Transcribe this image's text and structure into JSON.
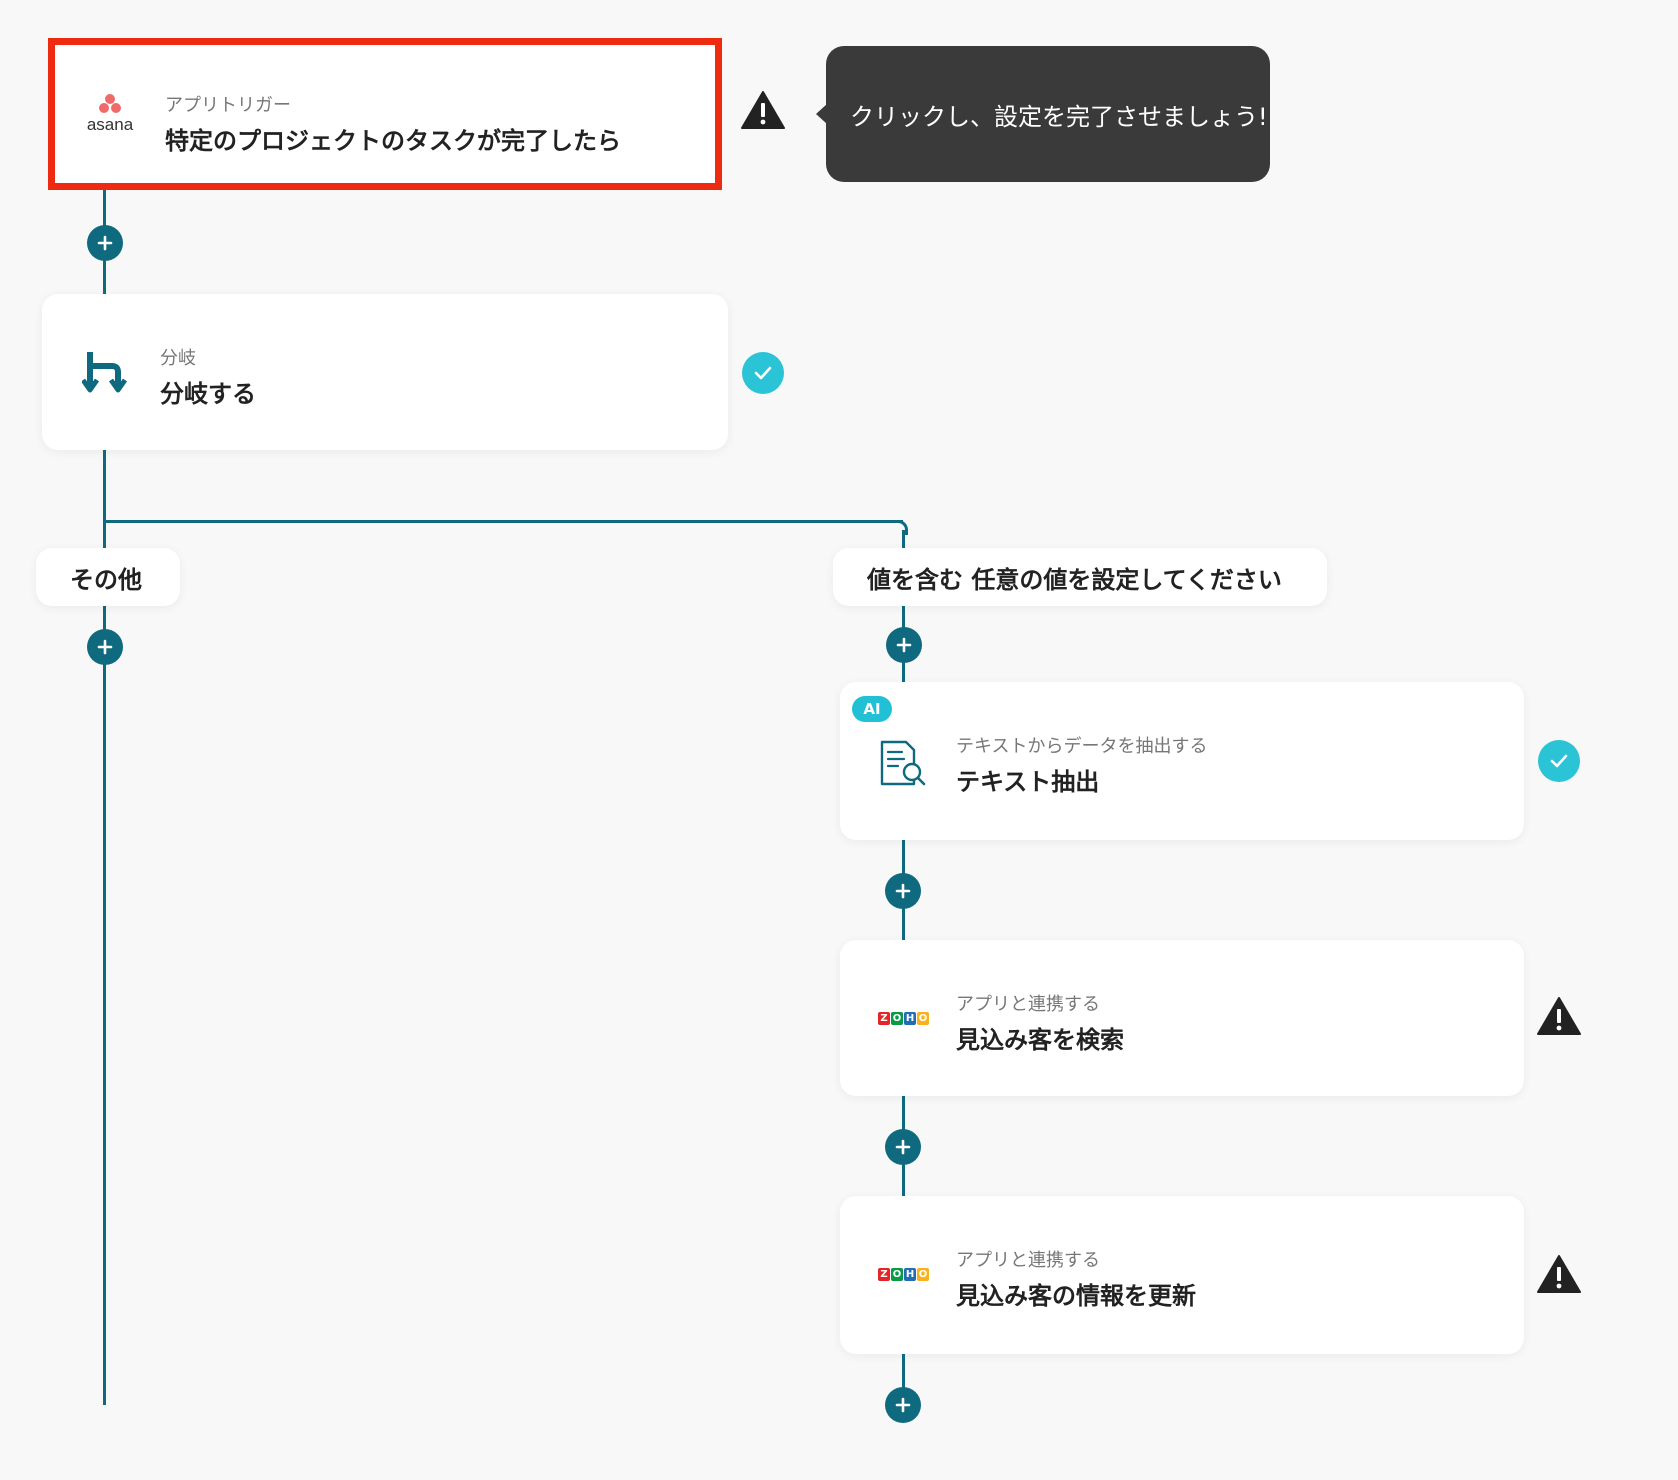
{
  "trigger": {
    "app_logo_text": "asana",
    "subtitle": "アプリトリガー",
    "title": "特定のプロジェクトのタスクが完了したら"
  },
  "tooltip": {
    "text": "クリックし、設定を完了させましょう!"
  },
  "branch_step": {
    "subtitle": "分岐",
    "title": "分岐する"
  },
  "branches": {
    "left_label": "その他",
    "right_label": "値を含む 任意の値を設定してください"
  },
  "steps": [
    {
      "badge": "AI",
      "subtitle": "テキストからデータを抽出する",
      "title": "テキスト抽出",
      "status": "complete"
    },
    {
      "logo": [
        "Z",
        "O",
        "H",
        "O"
      ],
      "subtitle": "アプリと連携する",
      "title": "見込み客を検索",
      "status": "warning"
    },
    {
      "logo": [
        "Z",
        "O",
        "H",
        "O"
      ],
      "subtitle": "アプリと連携する",
      "title": "見込み客の情報を更新",
      "status": "warning"
    }
  ],
  "colors": {
    "connector": "#0f6a80",
    "highlight_border": "#ee2a11",
    "check": "#2bc3d6",
    "tooltip_bg": "#3a3a3a",
    "asana": "#f06a6a"
  },
  "icons": {
    "plus": "plus-icon",
    "warning": "warning-icon",
    "check": "check-icon",
    "branch": "branch-icon",
    "text_extract": "document-search-icon"
  }
}
